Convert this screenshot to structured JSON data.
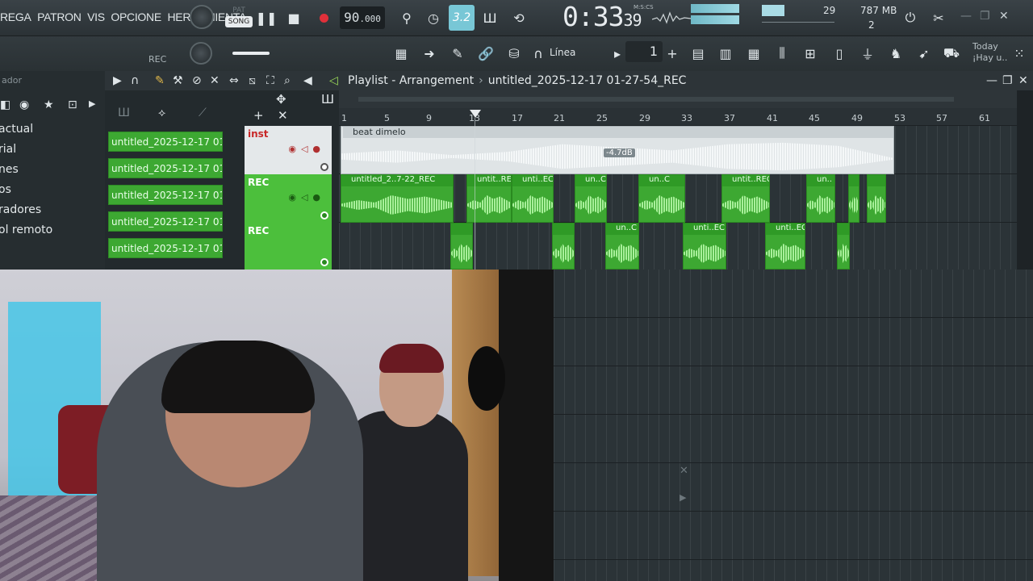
{
  "toolbar": {
    "menu": [
      "REGA",
      "PATRON",
      "VIS",
      "OPCIONE",
      "HERRAMIENTA"
    ],
    "pat_label": "PAT",
    "song_label": "SONG",
    "tempo_int": "90",
    "tempo_dec": ".000",
    "steps_label": "3.2",
    "time_main": "0:33",
    "time_cs": "39",
    "time_format": "M:S:CS",
    "polyphony": "29",
    "memory": "787 MB",
    "voices": "2",
    "rec_label": "REC",
    "snap_label": "Línea",
    "pattern_number": "1",
    "hint_line1": "Today",
    "hint_line2": "¡Hay u.."
  },
  "browser": {
    "title": "ador",
    "items": [
      "actual",
      "rial",
      "nes",
      "os",
      "radores",
      "ol remoto"
    ]
  },
  "playlist": {
    "title": "Playlist - Arrangement",
    "project": "untitled_2025-12-17 01-27-54_REC",
    "ruler": [
      "1",
      "5",
      "9",
      "13",
      "17",
      "21",
      "25",
      "29",
      "33",
      "37",
      "41",
      "45",
      "49",
      "53",
      "57",
      "61"
    ],
    "gain_label": "-4.7dB"
  },
  "clips_panel": {
    "items": [
      "untitled_2025-12-17 01...",
      "untitled_2025-12-17 01...",
      "untitled_2025-12-17 01...",
      "untitled_2025-12-17 01...",
      "untitled_2025-12-17 01..."
    ]
  },
  "tracks": [
    {
      "name": "inst"
    },
    {
      "name": "REC"
    },
    {
      "name": "REC"
    }
  ],
  "audio_clips": {
    "beat": "beat dimelo",
    "rec1": [
      "untitled_2..7-22_REC",
      "untit..REC",
      "unti..EC",
      "un..C",
      "un..C",
      "untit..REC",
      "un..",
      "",
      ""
    ],
    "rec2": [
      "",
      "",
      "un..C",
      "unti..EC",
      "unti..EC",
      ""
    ]
  },
  "colors": {
    "accent": "#78c7d6",
    "clip_green": "#3da832",
    "record": "#e0303a"
  }
}
